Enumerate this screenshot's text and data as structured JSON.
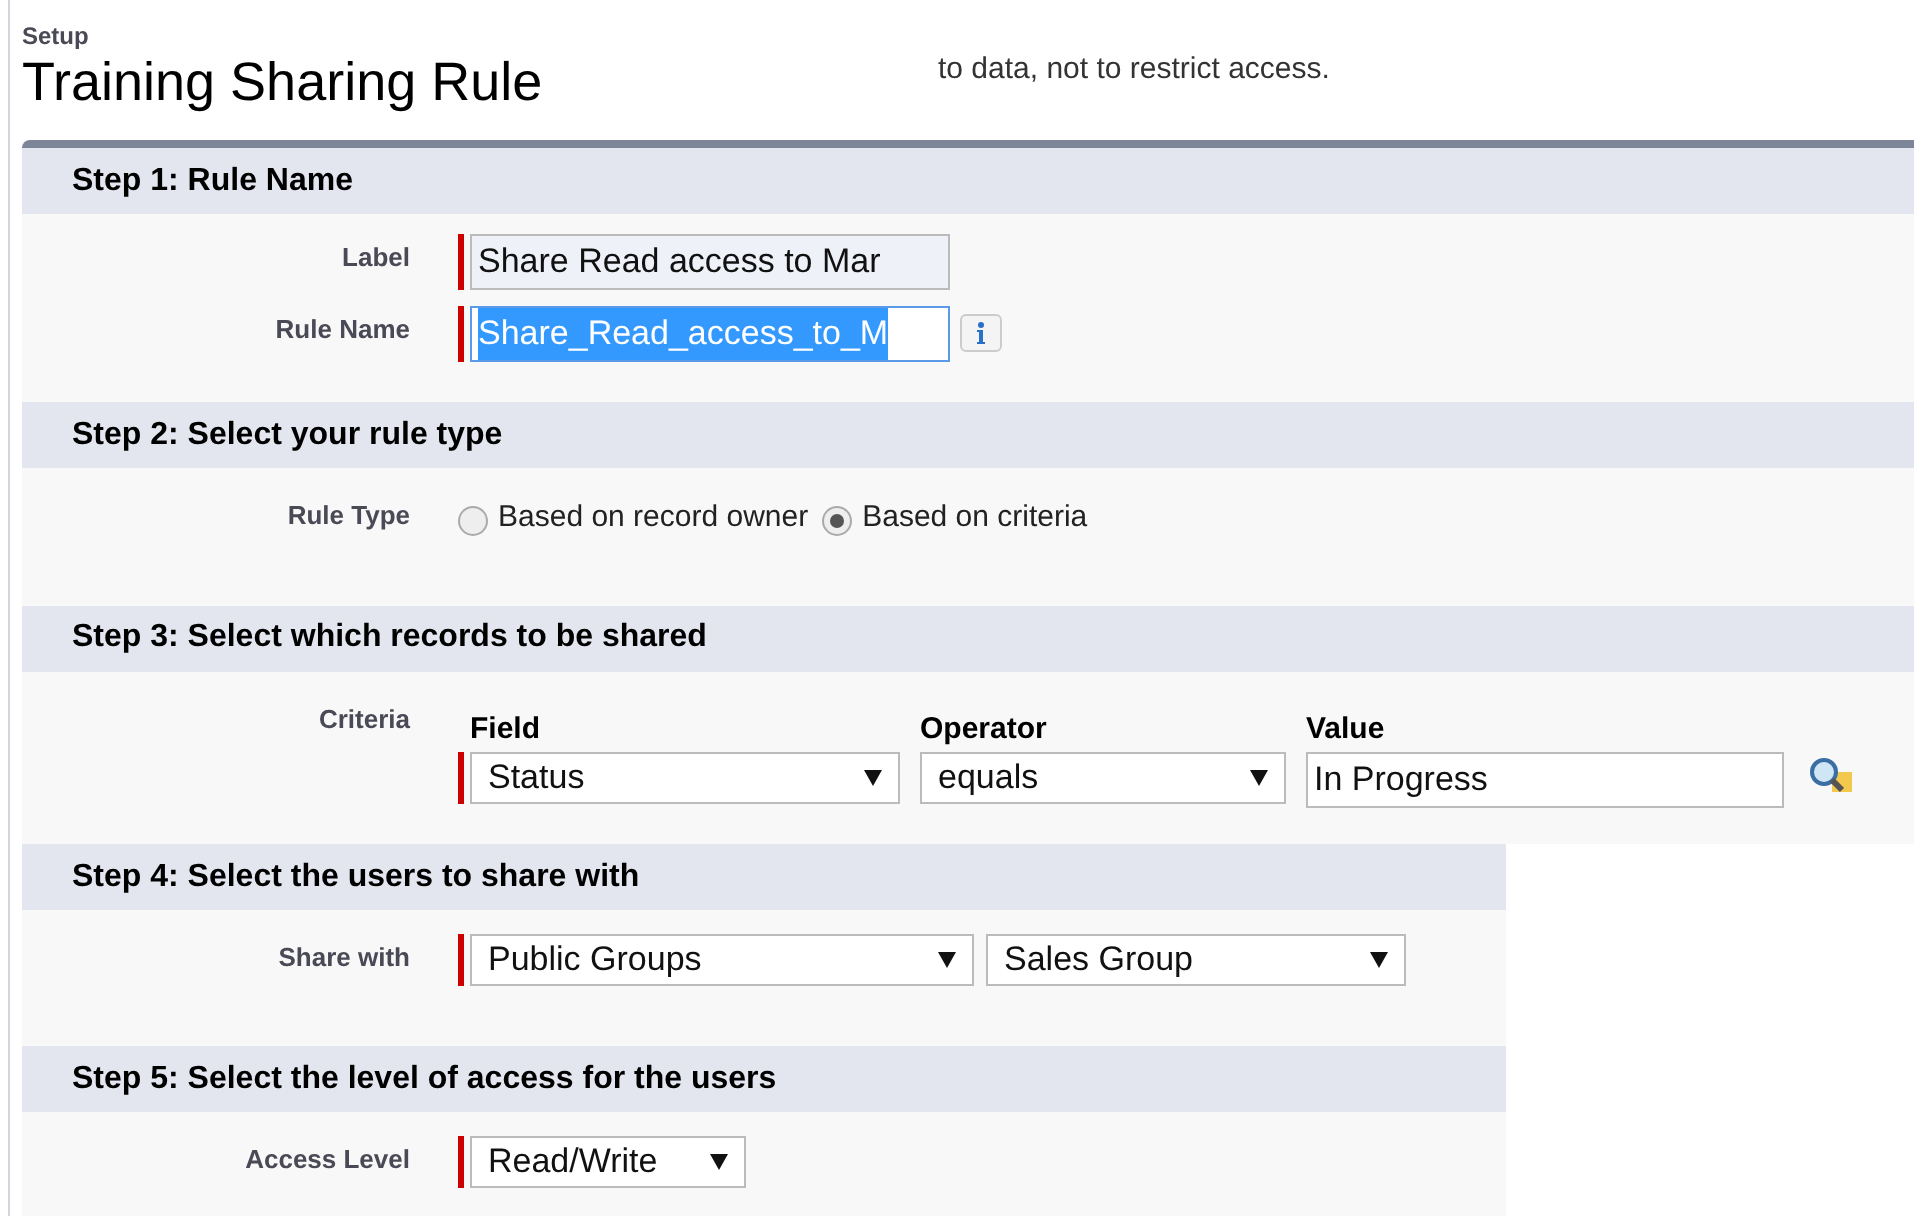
{
  "breadcrumb": "Setup",
  "title": "Training Sharing Rule",
  "note": "to data, not to restrict access.",
  "steps": [
    {
      "title": "Step 1: Rule Name",
      "rows": [
        {
          "kind": "text",
          "label": "Label",
          "required": true,
          "value": "Share Read access to Mar",
          "selected": false,
          "info": false
        },
        {
          "kind": "text",
          "label": "Rule Name",
          "required": true,
          "value": "Share_Read_access_to_M",
          "selected": true,
          "info": true
        }
      ]
    },
    {
      "title": "Step 2: Select your rule type",
      "rows": [
        {
          "kind": "radio",
          "label": "Rule Type",
          "options": [
            {
              "label": "Based on record owner",
              "selected": false
            },
            {
              "label": "Based on criteria",
              "selected": true
            }
          ]
        }
      ]
    },
    {
      "title": "Step 3: Select which records to be shared",
      "rows": [
        {
          "kind": "criteria",
          "label": "Criteria",
          "columns": [
            {
              "heading": "Field",
              "kind": "select",
              "value": "Status",
              "required": true
            },
            {
              "heading": "Operator",
              "kind": "select",
              "value": "equals"
            },
            {
              "heading": "Value",
              "kind": "lookup",
              "value": "In Progress"
            }
          ]
        }
      ]
    },
    {
      "title": "Step 4: Select the users to share with",
      "rows": [
        {
          "kind": "selects",
          "label": "Share with",
          "required": true,
          "values": [
            "Public Groups",
            "Sales Group"
          ]
        }
      ]
    },
    {
      "title": "Step 5: Select the level of access for the users",
      "rows": [
        {
          "kind": "selects",
          "label": "Access Level",
          "required": true,
          "values": [
            "Read/Write"
          ]
        }
      ]
    }
  ]
}
